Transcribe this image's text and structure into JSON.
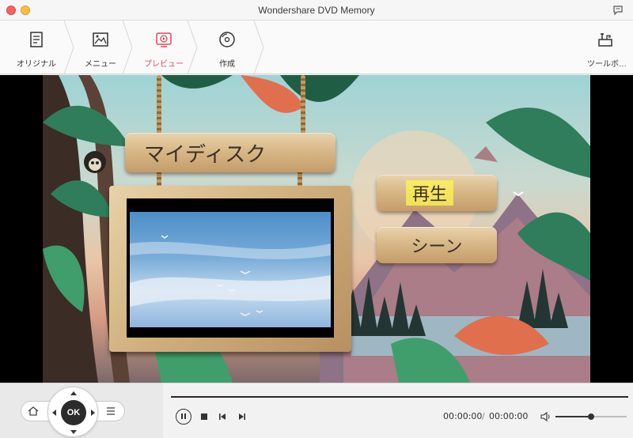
{
  "window": {
    "title": "Wondershare DVD Memory"
  },
  "toolbar": {
    "steps": [
      {
        "label": "オリジナル",
        "icon": "document-icon"
      },
      {
        "label": "メニュー",
        "icon": "image-icon"
      },
      {
        "label": "プレビュー",
        "icon": "play-preview-icon"
      },
      {
        "label": "作成",
        "icon": "disc-burn-icon"
      }
    ],
    "active_step": "プレビュー",
    "toolbox_label": "ツールボ…",
    "accent_color": "#e8455a"
  },
  "menu_preview": {
    "disc_title": "マイディスク",
    "play_button": "再生",
    "scenes_button": "シーン"
  },
  "player": {
    "ok_label": "OK",
    "current_time": "00:00:00",
    "separator": "/",
    "total_time": "00:00:00",
    "volume_fraction": 0.5,
    "progress_fraction": 0
  }
}
